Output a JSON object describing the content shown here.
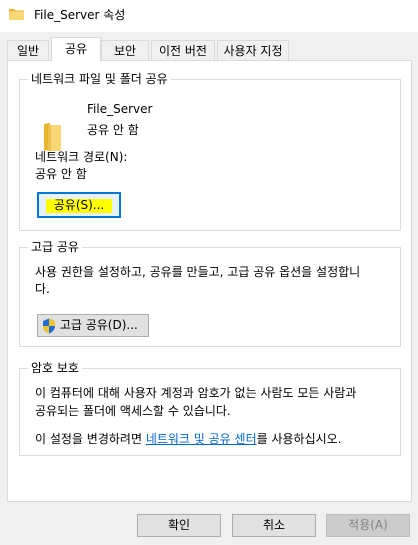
{
  "window": {
    "title": "File_Server 속성",
    "icon": "folder-icon"
  },
  "tabs": [
    {
      "label": "일반",
      "active": false
    },
    {
      "label": "공유",
      "active": true
    },
    {
      "label": "보안",
      "active": false
    },
    {
      "label": "이전 버전",
      "active": false
    },
    {
      "label": "사용자 지정",
      "active": false
    }
  ],
  "network_sharing": {
    "group_title": "네트워크 파일 및 폴더 공유",
    "folder_name": "File_Server",
    "share_status": "공유 안 함",
    "path_label": "네트워크 경로(N):",
    "path_value": "공유 안 함",
    "share_button": "공유(S)...",
    "share_button_highlight": "#ffff00"
  },
  "advanced_sharing": {
    "group_title": "고급 공유",
    "description_line1": "사용 권한을 설정하고, 공유를 만들고, 고급 공유 옵션을 설정합니",
    "description_line2": "다.",
    "button": "고급 공유(D)...",
    "button_icon": "uac-shield-icon"
  },
  "password_protection": {
    "group_title": "암호 보호",
    "description_line1": "이 컴퓨터에 대해 사용자 계정과 암호가 없는 사람도 모든 사람과",
    "description_line2": "공유되는 폴더에 액세스할 수 있습니다.",
    "change_prefix": "이 설정을 변경하려면 ",
    "link_text": "네트워크 및 공유 센터",
    "change_suffix": "를 사용하십시오."
  },
  "footer": {
    "ok": "확인",
    "cancel": "취소",
    "apply": "적용(A)"
  }
}
